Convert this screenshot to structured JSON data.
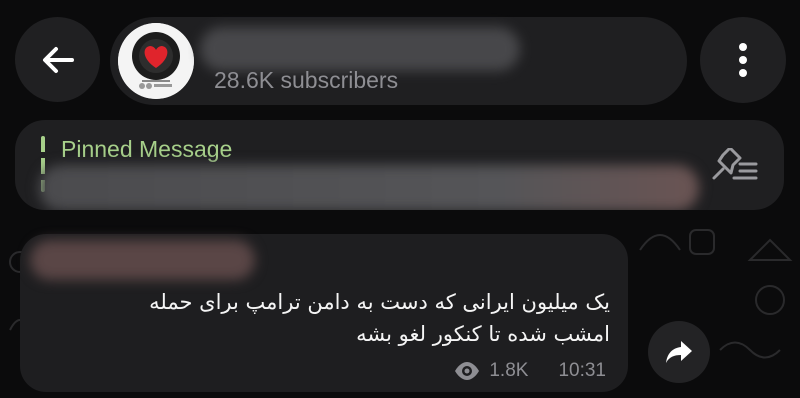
{
  "header": {
    "back_icon": "arrow-left-icon",
    "channel_name": "",
    "subscribers": "28.6K subscribers",
    "menu_icon": "vertical-dots-icon"
  },
  "pinned": {
    "title": "Pinned Message",
    "preview": "",
    "icon": "pin-list-icon",
    "accent_color": "#a7d08a"
  },
  "message": {
    "sender": "",
    "text_line1": "یک میلیون ایرانی که دست به دامن ترامپ برای حمله",
    "text_line2": "امشب شده تا کنکور لغو بشه",
    "views": "1.8K",
    "time": "10:31",
    "views_icon": "eye-icon",
    "forward_icon": "forward-arrow-icon"
  },
  "colors": {
    "background": "#0b0b0c",
    "surface": "#1f1f21",
    "muted_text": "#8e8e93",
    "text": "#f5f5f5"
  }
}
